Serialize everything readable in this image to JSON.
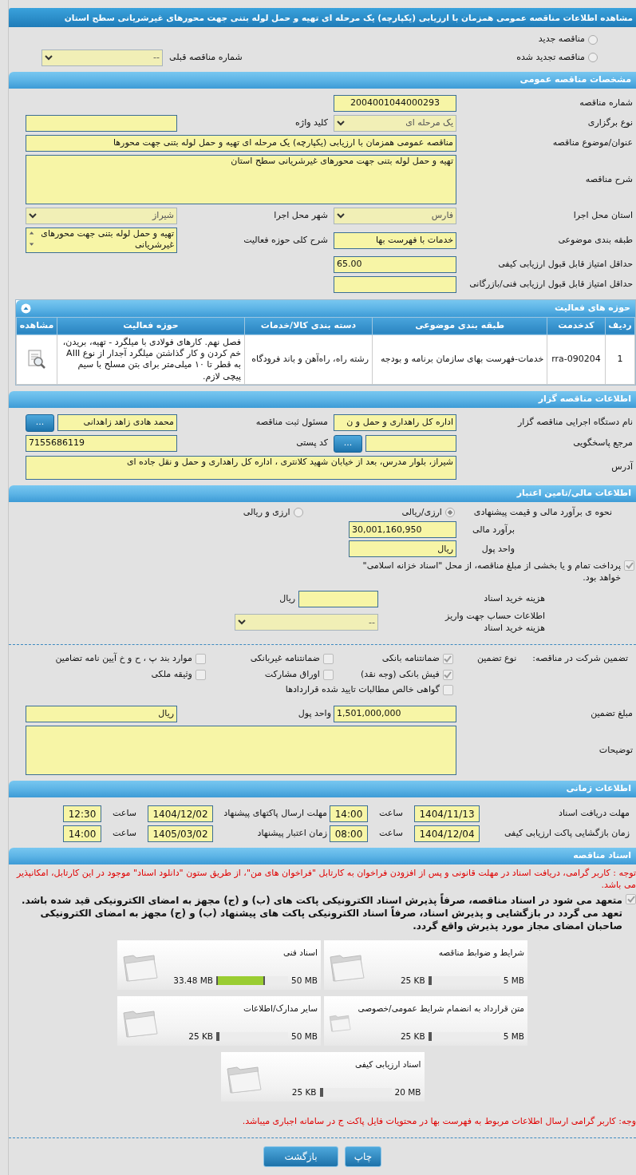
{
  "title": "مشاهده اطلاعات مناقصه عمومی همزمان با ارزیابی (یکپارچه) یک مرحله ای تهیه و حمل لوله بتنی جهت محورهای غیرشریانی سطح استان",
  "tender_kind": [
    {
      "label": "مناقصه جدید",
      "selected": false
    },
    {
      "label": "مناقصه تجدید شده",
      "selected": false
    }
  ],
  "previous_tender": {
    "label": "شماره مناقصه قبلی",
    "value": "--"
  },
  "general": {
    "heading": "مشخصات مناقصه عمومی",
    "rows": [
      [
        {
          "label": "شماره مناقصه",
          "value": "2004001044000293",
          "kind": "code"
        }
      ],
      [
        {
          "label": "نوع برگزاری",
          "value": "یک مرحله ای",
          "kind": "select"
        },
        {
          "label": "کلید واژه",
          "kind": "input"
        }
      ],
      [
        {
          "label": "عنوان/موضوع مناقصه",
          "value": "مناقصه عمومی همزمان با ارزیابی (یکپارچه) یک مرحله ای تهیه و حمل لوله بتنی جهت محورها",
          "kind": "long_input"
        }
      ],
      [
        {
          "label": "شرح مناقصه",
          "value": "تهیه و حمل لوله بتنی جهت محورهای غیرشریانی سطح استان",
          "kind": "textarea"
        }
      ],
      [
        {
          "label": "استان محل اجرا",
          "value": "فارس",
          "kind": "select"
        },
        {
          "label": "شهر محل اجرا",
          "value": "شیراز",
          "kind": "select"
        }
      ],
      [
        {
          "label": "طبقه بندی موضوعی",
          "value": "خدمات با فهرست بها",
          "kind": "input"
        },
        {
          "label": "شرح کلی حوزه فعالیت",
          "value": "تهیه و حمل لوله بتنی جهت محورهای غیرشریانی",
          "kind": "listbox"
        }
      ],
      [
        {
          "label": "حداقل امتیاز قابل قبول ارزیابی کیفی",
          "value": "65.00",
          "kind": "number"
        }
      ],
      [
        {
          "label": "حداقل امتیاز قابل قبول ارزیابی فنی/بازرگانی",
          "kind": "number"
        }
      ]
    ]
  },
  "activities": {
    "heading": "حوزه های فعالیت",
    "columns": [
      "ردیف",
      "کدخدمت",
      "طبقه بندی موضوعی",
      "دسته بندی کالا/خدمات",
      "حوزه فعالیت",
      "مشاهده"
    ],
    "rows": [
      {
        "cells": [
          "1",
          "rra-090204",
          "خدمات-فهرست بهای سازمان برنامه و بودجه",
          "رشته راه، راه‌آهن و باند فرودگاه",
          "فصل نهم. کارهای فولادی با میلگرد - تهیه، بریدن، خم کردن و کار گذاشتن میلگرد آجدار از نوع AIII به قطر تا ۱۰ میلی‌متر برای بتن مسلح با سیم پیچی لازم."
        ]
      }
    ]
  },
  "organizer": {
    "heading": "اطلاعات مناقصه گزار",
    "rows": [
      [
        {
          "label": "نام دستگاه اجرایی مناقصه گزار",
          "value": "اداره کل راهداری و حمل و ن",
          "kind": "input"
        },
        {
          "label": "مسئول ثبت مناقصه",
          "value": "محمد هادی  زاهد زاهدانی",
          "kind": "input",
          "action": "..."
        }
      ],
      [
        {
          "label": "مرجع پاسخگویی",
          "kind": "input",
          "action": "..."
        },
        {
          "label": "کد پستی",
          "value": "7155686119",
          "kind": "number"
        }
      ],
      [
        {
          "label": "آدرس",
          "value": "شیراز، بلوار مدرس، بعد از خیابان شهید کلانتری ، اداره کل راهداری و حمل و نقل جاده ای",
          "kind": "memo"
        }
      ]
    ]
  },
  "finance": {
    "heading": "اطلاعات مالی/تامین اعتبار",
    "estimate_method": {
      "label": "نحوه ی برآورد مالی و قیمت پیشنهادی",
      "options": [
        {
          "label": "ارزی/ریالی",
          "selected": true
        },
        {
          "label": "ارزی و ریالی",
          "selected": false
        }
      ]
    },
    "rows": [
      [
        {
          "label": "برآورد مالی",
          "value": "30,001,160,950",
          "kind": "number"
        }
      ],
      [
        {
          "label": "واحد پول",
          "value": "ریال",
          "kind": "input"
        }
      ]
    ],
    "treasury": {
      "label": "پرداخت تمام و یا بخشی از مبلغ مناقصه، از محل \"اسناد خزانه اسلامی\" خواهد بود.",
      "checked": true
    },
    "rows2": [
      [
        {
          "label": "هزینه خرید اسناد",
          "kind": "input",
          "suffix": "ریال"
        }
      ],
      [
        {
          "label": "اطلاعات حساب جهت واریز هزینه خرید اسناد",
          "value": "--",
          "kind": "select"
        }
      ]
    ]
  },
  "guarantee": {
    "label": "تضمین شرکت در مناقصه:",
    "type_label": "نوع تضمین",
    "options": [
      {
        "label": "ضمانتنامه بانکی",
        "checked": true
      },
      {
        "label": "ضمانتنامه غیربانکی",
        "checked": false
      },
      {
        "label": "موارد بند پ ، ح و خ آیین نامه تضامین",
        "checked": false
      },
      {
        "label": "فیش بانکی (وجه نقد)",
        "checked": true
      },
      {
        "label": "اوراق مشارکت",
        "checked": false
      },
      {
        "label": "وثیقه ملکی",
        "checked": false
      },
      {
        "label": "گواهی خالص مطالبات تایید شده قراردادها",
        "checked": false
      }
    ],
    "rows": [
      [
        {
          "label": "مبلغ تضمین",
          "value": "1,501,000,000",
          "kind": "number"
        },
        {
          "label": "واحد پول",
          "value": "ریال",
          "kind": "input"
        }
      ],
      [
        {
          "label": "توضیحات",
          "kind": "textarea"
        }
      ]
    ]
  },
  "schedule": {
    "heading": "اطلاعات زمانی",
    "items": [
      {
        "label": "مهلت دریافت اسناد",
        "date": "1404/11/13",
        "time_label": "ساعت",
        "time": "14:00"
      },
      {
        "label": "مهلت ارسال پاکتهای پیشنهاد",
        "date": "1404/12/02",
        "time_label": "ساعت",
        "time": "12:30"
      },
      {
        "label": "زمان بازگشایی پاکت ارزیابی کیفی",
        "date": "1404/12/04",
        "time_label": "ساعت",
        "time": "08:00"
      },
      {
        "label": "زمان اعتبار پیشنهاد",
        "date": "1405/03/02",
        "time_label": "ساعت",
        "time": "14:00"
      }
    ]
  },
  "documents": {
    "heading": "اسناد مناقصه",
    "notice": "توجه : کاربر گرامی، دریافت اسناد در مهلت قانونی و پس از افزودن فراخوان به کارتابل \"فراخوان های من\"، از طریق ستون \"دانلود اسناد\" موجود در این کارتابل، امکانپذیر می باشد.",
    "commitment": {
      "text": "متعهد می شود در اسناد مناقصه، صرفاً پذیرش اسناد الکترونیکی پاکت های (ب) و (ج) مجهز به امضای الکترونیکی قید شده باشد. تعهد می گردد در بازگشایی و پذیرش اسناد، صرفاً اسناد الکترونیکی پاکت های پیشنهاد (ب) و (ج) مجهز به امضای الکترونیکی صاحبان امضای مجاز مورد پذیرش واقع گردد.",
      "checked": true
    },
    "files": [
      {
        "title": "شرایط و ضوابط مناقصه",
        "max": "5 MB",
        "used": "25 KB",
        "level": 0.005
      },
      {
        "title": "اسناد فنی",
        "max": "50 MB",
        "used": "33.48 MB",
        "level": 0.67
      },
      {
        "title": "متن قرارداد به انضمام شرایط عمومی/خصوصی",
        "max": "5 MB",
        "used": "25 KB",
        "level": 0.005
      },
      {
        "title": "سایر مدارک/اطلاعات",
        "max": "50 MB",
        "used": "25 KB",
        "level": 0.005
      },
      {
        "title": "اسناد ارزیابی کیفی",
        "max": "20 MB",
        "used": "25 KB",
        "level": 0.005
      }
    ],
    "footer_notice": "وجه: کاربر گرامی ارسال اطلاعات مربوط به فهرست بها در محتویات فایل پاکت ج در سامانه اجباری میباشد."
  },
  "buttons": [
    "چاپ",
    "بازگشت"
  ]
}
